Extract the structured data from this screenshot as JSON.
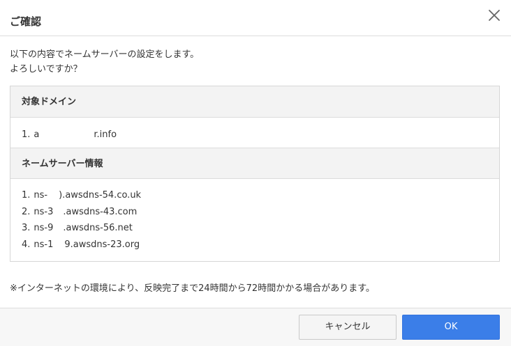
{
  "dialog": {
    "title": "ご確認",
    "intro_line1": "以下の内容でネームサーバーの設定をします。",
    "intro_line2": "よろしいですか？",
    "domain_section": {
      "heading": "対象ドメイン",
      "items": [
        {
          "num": "1.",
          "prefix": "a",
          "suffix": "r.info"
        }
      ]
    },
    "ns_section": {
      "heading": "ネームサーバー情報",
      "items": [
        {
          "num": "1.",
          "prefix": "ns-",
          "suffix": ").awsdns-54.co.uk"
        },
        {
          "num": "2.",
          "prefix": "ns-3",
          "suffix": ".awsdns-43.com"
        },
        {
          "num": "3.",
          "prefix": "ns-9",
          "suffix": ".awsdns-56.net"
        },
        {
          "num": "4.",
          "prefix": "ns-1",
          "suffix": "9.awsdns-23.org"
        }
      ]
    },
    "note": "※インターネットの環境により、反映完了まで24時間から72時間かかる場合があります。",
    "cancel_label": "キャンセル",
    "ok_label": "OK",
    "close_icon": "close-icon"
  }
}
